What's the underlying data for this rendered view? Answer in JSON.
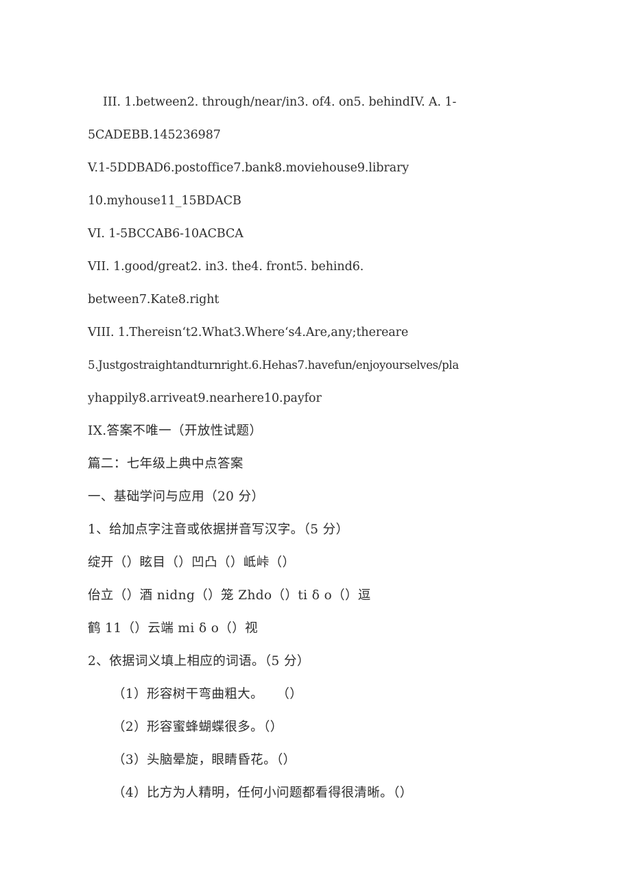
{
  "document": {
    "background_color": "#ffffff",
    "text_color": "#2e2e2e",
    "lines": [
      {
        "id": "l1",
        "text": "III. 1.between2. through/near/in3. of4. on5. behindIV. A. 1-"
      },
      {
        "id": "l2",
        "text": "5CADEBB.145236987"
      },
      {
        "id": "l3",
        "text": "V.1-5DDBAD6.postoffice7.bank8.moviehouse9.library"
      },
      {
        "id": "l4",
        "text": "10.myhouse11_15BDACB"
      },
      {
        "id": "l5",
        "text": "VI.  1-5BCCAB6-10ACBCA"
      },
      {
        "id": "l6",
        "text": "VII.  1.good/great2. in3. the4. front5. behind6."
      },
      {
        "id": "l7",
        "text": "between7.Kate8.right"
      },
      {
        "id": "l8",
        "text": "VIII.  1.Thereisnʻt2.What3.Whereʻs4.Are,any;thereare"
      },
      {
        "id": "l9",
        "text": "5.Justgostraightandturnright.6.Hehas7.havefun/enjoyourselves/pla"
      },
      {
        "id": "l10",
        "text": "yhappily8.arriveat9.nearhere10.payfor"
      },
      {
        "id": "l11",
        "text": "IX.答案不唯一（开放性试题）"
      },
      {
        "id": "l12",
        "text": "篇二：七年级上典中点答案"
      },
      {
        "id": "l13",
        "text": "一、基础学问与应用（20 分）"
      },
      {
        "id": "l14",
        "text": "1、给加点字注音或依据拼音写汉字。（5 分）"
      },
      {
        "id": "l15",
        "text": "绽开（）眩目（）凹凸（）岻峠（）"
      },
      {
        "id": "l16",
        "text": "佁立（）酒 nidng（）笼 Zhdo（）ti δ o（）逗"
      },
      {
        "id": "l17",
        "text": "鹤 11（）云端 mi δ o（）视"
      },
      {
        "id": "l18",
        "text": "2、依据词义填上相应的词语。（5 分）"
      },
      {
        "id": "l19",
        "text": "（1）形容树干弯曲粗大。　　（）"
      },
      {
        "id": "l20",
        "text": "（2）形容蜜蜂蝴蝶很多。（）"
      },
      {
        "id": "l21",
        "text": "（3）头脑晕旋，眼睛昏花。（）"
      },
      {
        "id": "l22",
        "text": "（4）比方为人精明，任何小问题都看得很清晰。（）"
      }
    ]
  }
}
